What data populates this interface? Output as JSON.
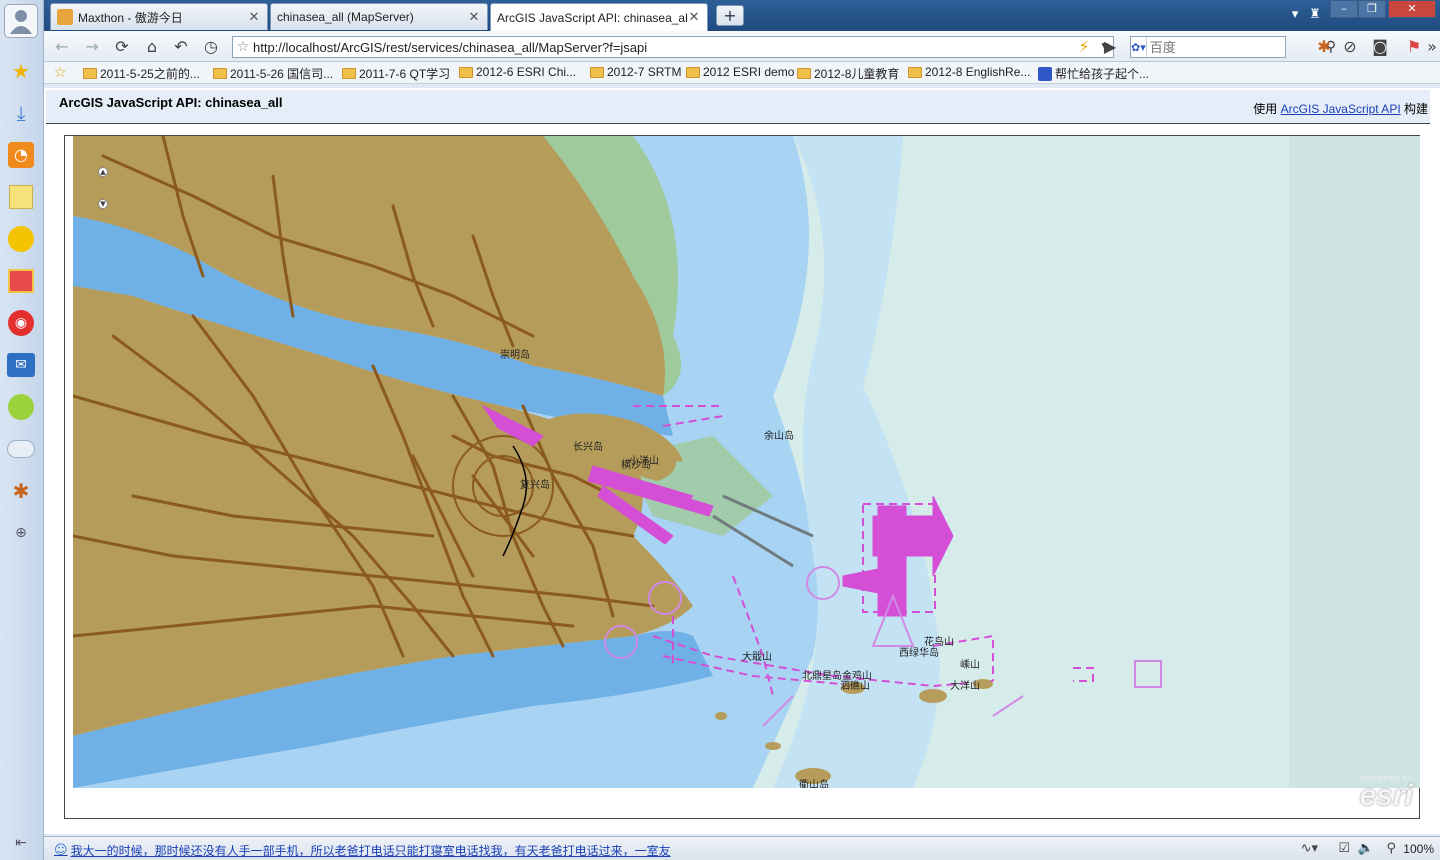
{
  "browser": {
    "tabs": [
      {
        "title": "Maxthon - 傲游今日"
      },
      {
        "title": "chinasea_all (MapServer)"
      },
      {
        "title": "ArcGIS JavaScript API: chinasea_all"
      }
    ],
    "url": "http://localhost/ArcGIS/rest/services/chinasea_all/MapServer?f=jsapi",
    "search_placeholder": "百度",
    "favorites": [
      "2011-5-25之前的...",
      "2011-5-26 国信司...",
      "2011-7-6 QT学习",
      "2012-6 ESRI Chi...",
      "2012-7 SRTM",
      "2012 ESRI demo",
      "2012-8儿童教育",
      "2012-8 EnglishRe...",
      "帮忙给孩子起个..."
    ],
    "status_text": "我大一的时候，那时候还没有人手一部手机，所以老爸打电话只能打寝室电话找我，有天老爸打电话过来，一室友",
    "zoom": "100%"
  },
  "page": {
    "title": "ArcGIS JavaScript API: chinasea_all",
    "built_prefix": "使用 ",
    "built_link": "ArcGIS JavaScript API",
    "built_suffix": " 构建"
  },
  "map": {
    "labels": [
      "崇明岛",
      "余山岛",
      "长兴岛",
      "横沙岛",
      "复兴岛",
      "大戢山",
      "北鼎星岛金鸡山",
      "西绿华岛",
      "花鸟山",
      "泗礁山",
      "嵊山",
      "衢山岛",
      "大洋山",
      "小洋山"
    ],
    "attribution_small": "POWERED BY",
    "attribution_brand": "esri"
  },
  "colors": {
    "land": "#b69c5a",
    "road": "#8a5a1e",
    "river": "#6fb0e6",
    "shallow": "#a8d0f0",
    "sea": "#d5ece9",
    "symbol": "#d44fd6"
  }
}
